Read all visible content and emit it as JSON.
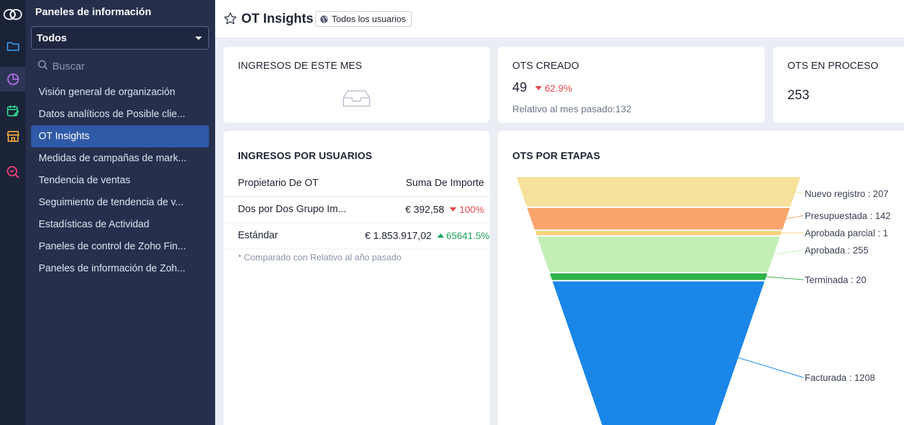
{
  "sidebar": {
    "title": "Paneles de información",
    "filter": "Todos",
    "search_placeholder": "Buscar",
    "items": [
      {
        "label": "Visión general de organización"
      },
      {
        "label": "Datos analíticos de Posible clie..."
      },
      {
        "label": "OT Insights",
        "active": true
      },
      {
        "label": "Medidas de campañas de mark..."
      },
      {
        "label": "Tendencia de ventas"
      },
      {
        "label": "Seguimiento de tendencia de v..."
      },
      {
        "label": "Estadísticas de Actividad"
      },
      {
        "label": "Paneles de control de Zoho Fin..."
      },
      {
        "label": "Paneles de información de Zoh..."
      }
    ]
  },
  "header": {
    "title": "OT Insights",
    "visibility": "Todos los usuarios"
  },
  "kpis": {
    "ingresos_mes": {
      "title": "INGRESOS DE ESTE MES"
    },
    "ots_creado": {
      "title": "OTS CREADO",
      "value": "49",
      "delta": "62.9%",
      "compare": "Relativo al mes pasado:132"
    },
    "ots_proceso": {
      "title": "OTS EN PROCESO",
      "value": "253"
    }
  },
  "revenue_by_user": {
    "title": "INGRESOS POR USUARIOS",
    "columns": [
      "Propietario De OT",
      "Suma De Importe"
    ],
    "rows": [
      {
        "owner": "Dos por Dos Grupo Im...",
        "amount": "€ 392,58",
        "delta": "100%",
        "direction": "down"
      },
      {
        "owner": "Estándar",
        "amount": "€ 1.853.917,02",
        "delta": "65641.5%",
        "direction": "up"
      }
    ],
    "note": "* Comparado con Relativo al año pasado"
  },
  "funnel": {
    "title": "OTS POR ETAPAS"
  },
  "chart_data": {
    "type": "funnel",
    "title": "OTS POR ETAPAS",
    "categories": [
      "Nuevo registro",
      "Presupuestada",
      "Aprobada parcial",
      "Aprobada",
      "Terminada",
      "Facturada"
    ],
    "values": [
      207,
      142,
      1,
      255,
      20,
      1208
    ],
    "labels": [
      "Nuevo registro : 207",
      "Presupuestada : 142",
      "Aprobada parcial : 1",
      "Aprobada : 255",
      "Terminada : 20",
      "Facturada : 1208"
    ],
    "colors": [
      "#f6e19b",
      "#fba46c",
      "#f7d27a",
      "#c4efb4",
      "#2fb14a",
      "#1a86e8"
    ]
  },
  "colors": {
    "accent": "#2f5aa8",
    "negative": "#e5484d",
    "positive": "#1fa35c"
  }
}
